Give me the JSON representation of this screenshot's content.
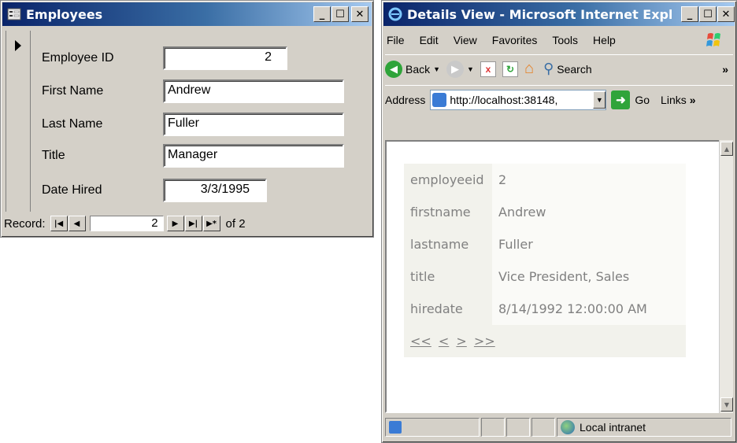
{
  "employees_window": {
    "title": "Employees",
    "icon": "form-icon",
    "fields": [
      {
        "label": "Employee ID",
        "value": "2",
        "align": "right"
      },
      {
        "label": "First Name",
        "value": "Andrew",
        "align": "left"
      },
      {
        "label": "Last Name",
        "value": "Fuller",
        "align": "left"
      },
      {
        "label": "Title",
        "value": "Manager",
        "align": "left"
      },
      {
        "label": "Date Hired",
        "value": "3/3/1995",
        "align": "right"
      }
    ],
    "record_nav": {
      "label": "Record:",
      "current": "2",
      "of_label": "of 2"
    }
  },
  "ie_window": {
    "title": "Details View - Microsoft Internet Explorer",
    "menu": [
      "File",
      "Edit",
      "View",
      "Favorites",
      "Tools",
      "Help"
    ],
    "toolbar": {
      "back_label": "Back",
      "search_label": "Search"
    },
    "address": {
      "label": "Address",
      "url": "http://localhost:38148,",
      "go_label": "Go",
      "links_label": "Links"
    },
    "details": [
      {
        "field": "employeeid",
        "value": "2"
      },
      {
        "field": "firstname",
        "value": "Andrew"
      },
      {
        "field": "lastname",
        "value": "Fuller"
      },
      {
        "field": "title",
        "value": "Vice President, Sales"
      },
      {
        "field": "hiredate",
        "value": "8/14/1992 12:00:00 AM"
      }
    ],
    "pager": [
      "<<",
      "<",
      ">",
      ">>"
    ],
    "status": {
      "zone": "Local intranet"
    }
  },
  "colors": {
    "titlebar_start": "#0a246a",
    "titlebar_end": "#a6caf0",
    "window_face": "#d4d0c8",
    "details_text": "#808080"
  }
}
